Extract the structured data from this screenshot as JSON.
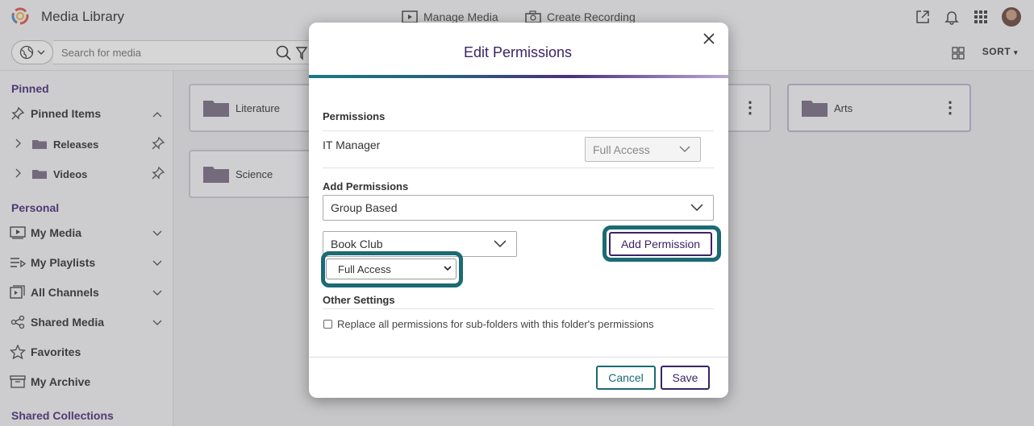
{
  "app": {
    "title": "Media Library",
    "nav_manage": "Manage Media",
    "nav_record": "Create Recording"
  },
  "search": {
    "placeholder": "Search for media",
    "sort_label": "SORT"
  },
  "sidebar": {
    "pinned_heading": "Pinned",
    "pinned_items": "Pinned Items",
    "pinned_sub": [
      "Releases",
      "Videos"
    ],
    "personal_heading": "Personal",
    "personal_items": [
      "My Media",
      "My Playlists",
      "All Channels",
      "Shared Media",
      "Favorites",
      "My Archive"
    ],
    "shared_heading": "Shared Collections"
  },
  "folders": [
    "Literature",
    "Arts",
    "Science"
  ],
  "modal": {
    "title": "Edit Permissions",
    "permissions_heading": "Permissions",
    "existing_user": "IT Manager",
    "existing_access": "Full Access",
    "add_heading": "Add Permissions",
    "type_select": "Group Based",
    "group_select": "Book Club",
    "access_select": "Full Access",
    "add_button": "Add Permission",
    "other_heading": "Other Settings",
    "checkbox_label": "Replace all permissions for sub-folders with this folder's permissions",
    "cancel_button": "Cancel",
    "save_button": "Save"
  },
  "colors": {
    "brand_purple": "#3a2466",
    "accent_teal": "#1a6a70",
    "highlight_ring": "#1c6a73"
  }
}
